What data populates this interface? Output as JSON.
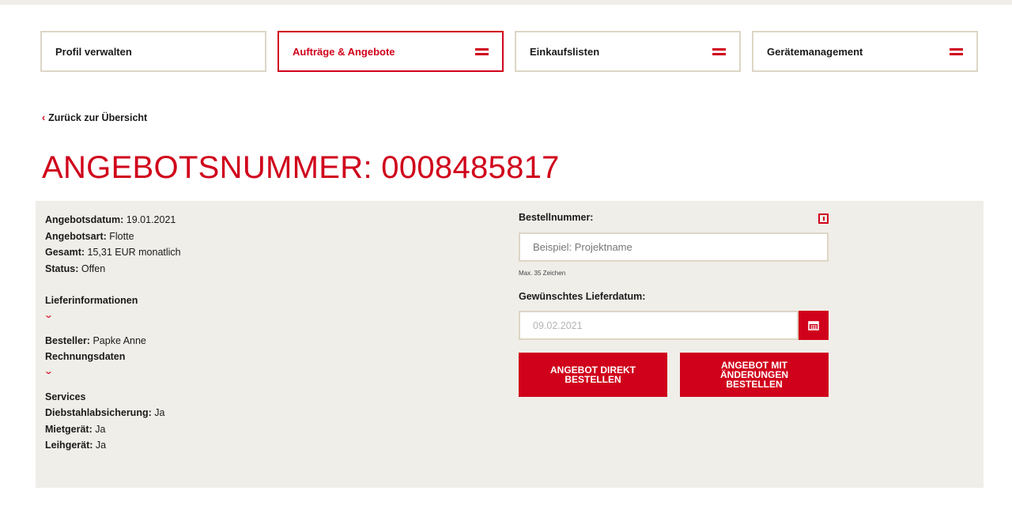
{
  "nav": {
    "tabs": [
      {
        "label": "Profil verwalten"
      },
      {
        "label": "Aufträge & Angebote"
      },
      {
        "label": "Einkaufslisten"
      },
      {
        "label": "Gerätemanagement"
      }
    ]
  },
  "back_link": {
    "chevron": "‹",
    "label": "Zurück zur Übersicht"
  },
  "page_title": "ANGEBOTSNUMMER: 0008485817",
  "offer": {
    "date_label": "Angebotsdatum:",
    "date_value": "19.01.2021",
    "type_label": "Angebotsart:",
    "type_value": "Flotte",
    "total_label": "Gesamt:",
    "total_value": "15,31 EUR monatlich",
    "status_label": "Status:",
    "status_value": "Offen"
  },
  "sections": {
    "delivery_info": "Lieferinformationen",
    "orderer_label": "Besteller:",
    "orderer_value": "Papke Anne",
    "billing": "Rechnungsdaten",
    "services": "Services",
    "theft_label": "Diebstahlabsicherung:",
    "theft_value": "Ja",
    "rental_label": "Mietgerät:",
    "rental_value": "Ja",
    "loan_label": "Leihgerät:",
    "loan_value": "Ja",
    "chevron": "⌄"
  },
  "form": {
    "order_number_label": "Bestellnummer:",
    "order_number_placeholder": "Beispiel: Projektname",
    "order_number_hint": "Max. 35 Zeichen",
    "delivery_date_label": "Gewünschtes Lieferdatum:",
    "delivery_date_value": "09.02.2021"
  },
  "buttons": {
    "order_direct": "ANGEBOT DIREKT\nBESTELLEN",
    "order_with_changes": "ANGEBOT MIT\nÄNDERUNGEN\nBESTELLEN"
  },
  "icons": {
    "menu": "menu-icon",
    "info": "info-icon",
    "calendar": "calendar-icon",
    "chevron_down": "chevron-down-icon",
    "chevron_left": "chevron-left-icon"
  },
  "colors": {
    "accent": "#d0021b",
    "panel_bg": "#f0eee9",
    "border": "#ddd6c6"
  }
}
